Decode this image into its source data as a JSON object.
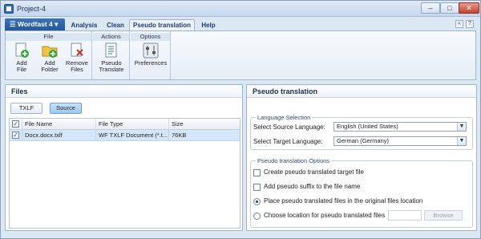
{
  "window": {
    "title": "Project-4"
  },
  "menu": {
    "app_button": "Wordfast 4",
    "tabs": [
      {
        "label": "Analysis"
      },
      {
        "label": "Clean"
      },
      {
        "label": "Pseudo translation",
        "active": true
      },
      {
        "label": "Help"
      }
    ]
  },
  "ribbon": {
    "groups": [
      {
        "label": "File",
        "buttons": [
          {
            "label": "Add\nFile",
            "icon": "add-file-icon"
          },
          {
            "label": "Add\nFolder",
            "icon": "add-folder-icon"
          },
          {
            "label": "Remove\nFiles",
            "icon": "remove-files-icon"
          }
        ]
      },
      {
        "label": "Actions",
        "buttons": [
          {
            "label": "Pseudo\nTranslate",
            "icon": "pseudo-translate-icon"
          }
        ]
      },
      {
        "label": "Options",
        "buttons": [
          {
            "label": "Preferences",
            "icon": "preferences-icon"
          }
        ]
      }
    ]
  },
  "files_panel": {
    "title": "Files",
    "toggle": [
      {
        "label": "TXLF",
        "selected": false
      },
      {
        "label": "Source",
        "selected": true
      }
    ],
    "columns": [
      "File Name",
      "File Type",
      "Size"
    ],
    "rows": [
      {
        "checked": true,
        "name": "Docx.docx.txlf",
        "type": "WF TXLF Document (*.t...",
        "size": "76KB"
      }
    ]
  },
  "pseudo_panel": {
    "title": "Pseudo translation",
    "language_selection": {
      "legend": "Language Selection",
      "source_label": "Select Source Language:",
      "source_value": "English (United States)",
      "target_label": "Select Target Language:",
      "target_value": "German (Germany)"
    },
    "options": {
      "legend": "Pseudo translation Options",
      "create_target": "Create pseudo translated target file",
      "add_suffix": "Add pseudo suffix to the file name",
      "place_original": "Place pseudo translated files in the original files location",
      "choose_location": "Choose location for pseudo translated files",
      "browse_label": "Browse",
      "selected_option": "place_original"
    }
  },
  "colors": {
    "accent": "#24569c",
    "background": "#dce7f4",
    "selection": "#d3e6fa"
  }
}
